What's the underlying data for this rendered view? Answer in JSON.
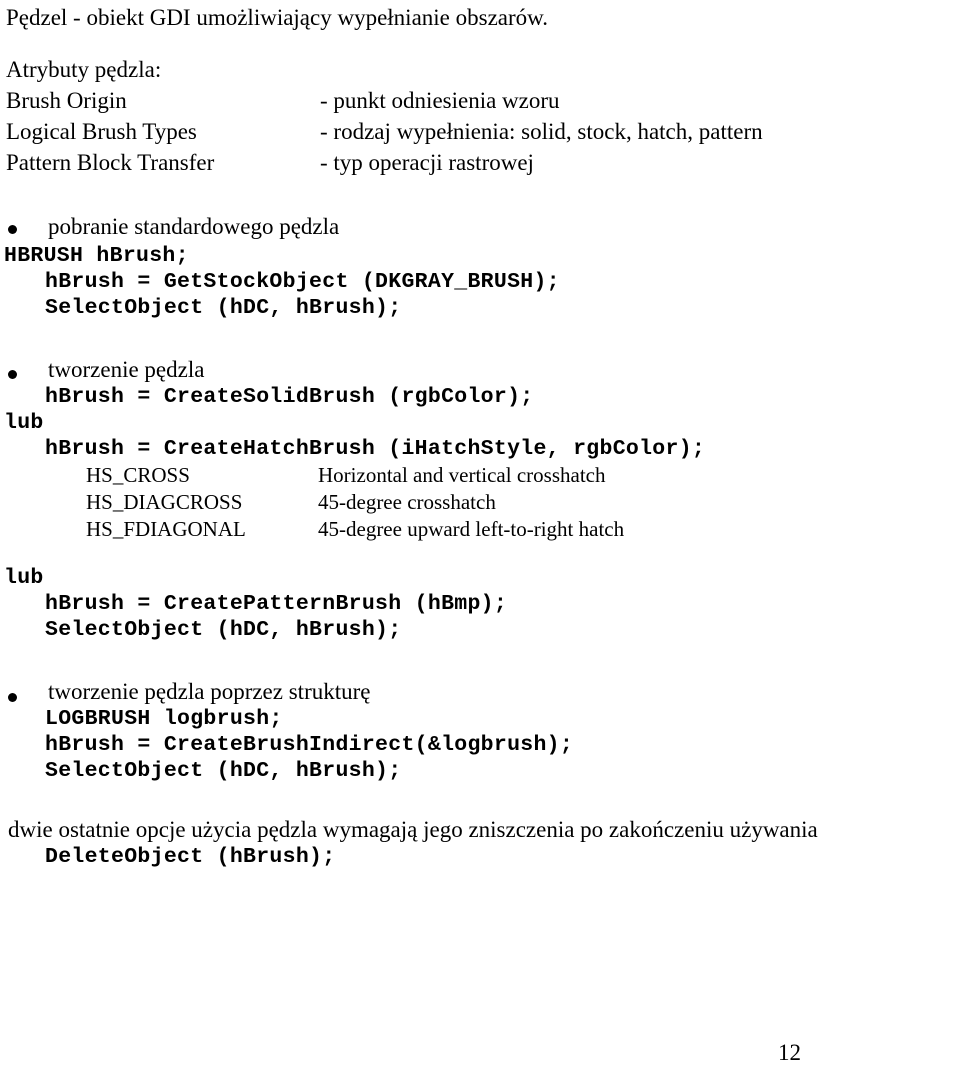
{
  "document": {
    "title_line": "Pędzel - obiekt GDI umożliwiający wypełnianie obszarów.",
    "page_number": "12"
  },
  "attributes_section": {
    "heading": "Atrybuty pędzla:",
    "rows": [
      {
        "term": "Brush Origin",
        "description": "- punkt odniesienia wzoru"
      },
      {
        "term": "Logical Brush Types",
        "description": "- rodzaj wypełnienia: solid, stock, hatch, pattern"
      },
      {
        "term": "Pattern Block Transfer",
        "description": "- typ operacji rastrowej"
      }
    ]
  },
  "stock_brush_section": {
    "bullet_label": "pobranie standardowego pędzla",
    "code": [
      "HBRUSH hBrush;",
      "hBrush = GetStockObject (DKGRAY_BRUSH);",
      "SelectObject (hDC, hBrush);"
    ]
  },
  "create_brush_section": {
    "bullet_label": "tworzenie pędzla",
    "code_solid": "hBrush = CreateSolidBrush (rgbColor);",
    "or_label": "lub",
    "code_hatch": "hBrush = CreateHatchBrush (iHatchStyle, rgbColor);",
    "hatch_styles": [
      {
        "name": "HS_CROSS",
        "description": "Horizontal and vertical crosshatch"
      },
      {
        "name": "HS_DIAGCROSS",
        "description": "45-degree crosshatch"
      },
      {
        "name": "HS_FDIAGONAL",
        "description": "45-degree upward left-to-right hatch"
      }
    ]
  },
  "pattern_brush_section": {
    "or_label": "lub",
    "code": [
      "hBrush = CreatePatternBrush (hBmp);",
      "SelectObject (hDC, hBrush);"
    ]
  },
  "struct_brush_section": {
    "bullet_label": "tworzenie pędzla poprzez strukturę",
    "code": [
      "LOGBRUSH logbrush;",
      "hBrush = CreateBrushIndirect(&logbrush);",
      "SelectObject (hDC, hBrush);"
    ]
  },
  "cleanup_section": {
    "note": "dwie ostatnie opcje użycia pędzla wymagają jego zniszczenia po zakończeniu używania",
    "code": "DeleteObject (hBrush);"
  }
}
